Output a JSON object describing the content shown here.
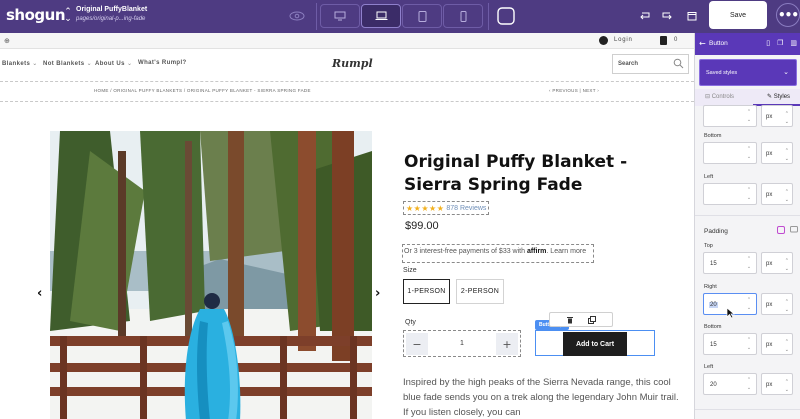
{
  "topbar": {
    "logo": "shogun",
    "page_name": "Original PuffyBlanket",
    "page_path": "pages/original-p...ing-fade",
    "save_label": "Save",
    "more_label": "•••"
  },
  "store": {
    "login": "Login",
    "cart_count": "0",
    "nav": [
      "Blankets",
      "Not Blankets",
      "About Us",
      "What's Rumpl?"
    ],
    "brand": "Rumpl",
    "search_placeholder": "Search",
    "breadcrumbs": "HOME  /  ORIGINAL PUFFY BLANKETS  /  ORIGINAL PUFFY BLANKET - SIERRA SPRING FADE",
    "pager": "‹ PREVIOUS  |  NEXT ›"
  },
  "product": {
    "title": "Original Puffy Blanket - Sierra Spring Fade",
    "stars": "★★★★★",
    "reviews": "878 Reviews",
    "price": "$99.00",
    "affirm_text": "Or 3 interest-free payments of $33 with",
    "affirm_brand": "affirm",
    "affirm_link": "Learn more",
    "size_label": "Size",
    "sizes": [
      "1-PERSON",
      "2-PERSON"
    ],
    "qty_label": "Qty",
    "qty_value": "1",
    "add_to_cart": "Add to Cart",
    "element_tag": "Button",
    "description": "Inspired by the high peaks of the Sierra Nevada range, this cool blue fade sends you on a trek along the legendary John Muir trail. If you listen closely, you can"
  },
  "panel": {
    "title": "Button",
    "saved_styles": "Saved styles",
    "tabs": [
      "Controls",
      "Styles"
    ],
    "active_tab": "Styles",
    "margin_fields": [
      {
        "label": "",
        "value": "",
        "unit": "px"
      },
      {
        "label": "Bottom",
        "value": "",
        "unit": "px"
      },
      {
        "label": "Left",
        "value": "",
        "unit": "px"
      }
    ],
    "padding_title": "Padding",
    "padding_fields": [
      {
        "label": "Top",
        "value": "15",
        "unit": "px"
      },
      {
        "label": "Right",
        "value": "20",
        "unit": "px"
      },
      {
        "label": "Bottom",
        "value": "15",
        "unit": "px"
      },
      {
        "label": "Left",
        "value": "20",
        "unit": "px"
      }
    ]
  },
  "colors": {
    "topbar": "#4e3b82",
    "panel_header": "#5a38b8",
    "selection": "#4c8ff2",
    "star": "#f2b01e"
  }
}
